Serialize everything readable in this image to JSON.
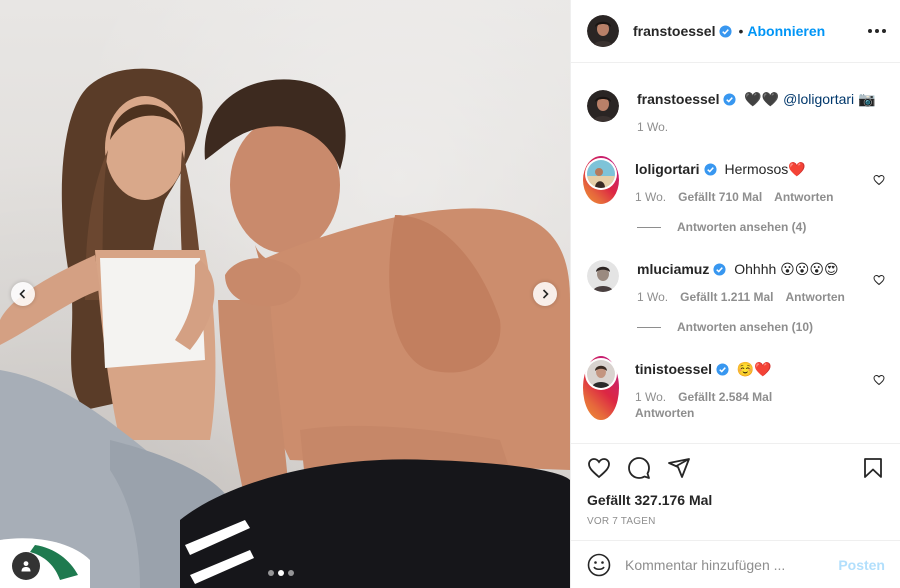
{
  "post": {
    "username": "franstoessel",
    "follow_label": "Abonnieren",
    "separator": "•",
    "caption_text": "🖤🖤",
    "caption_mention": "@loligortari",
    "caption_emoji": "📷",
    "caption_age": "1 Wo.",
    "likes": "Gefällt 327.176 Mal",
    "age": "VOR 7 TAGEN",
    "carousel": {
      "slides": 3,
      "active": 2
    }
  },
  "comments": [
    {
      "username": "loligortari",
      "text": "Hermosos❤️",
      "age": "1 Wo.",
      "likes": "Gefällt 710 Mal",
      "reply_label": "Antworten",
      "view_replies": "Antworten ansehen (4)"
    },
    {
      "username": "mluciamuz",
      "text": "Ohhhh 😮😮😮😍",
      "age": "1 Wo.",
      "likes": "Gefällt 1.211 Mal",
      "reply_label": "Antworten",
      "view_replies": "Antworten ansehen (10)"
    },
    {
      "username": "tinistoessel",
      "text": "☺️❤️",
      "age": "1 Wo.",
      "likes": "Gefällt 2.584 Mal",
      "reply_label": "Antworten"
    }
  ],
  "composer": {
    "placeholder": "Kommentar hinzufügen ...",
    "post_label": "Posten"
  },
  "icons": {
    "like": "heart-icon",
    "comment": "comment-icon",
    "share": "share-icon",
    "save": "bookmark-icon",
    "emoji": "emoji-icon",
    "more": "more-icon",
    "verified": "verified-icon"
  },
  "colors": {
    "accent": "#0095f6",
    "verified": "#3897f0",
    "post_disabled": "#b2dffc"
  }
}
